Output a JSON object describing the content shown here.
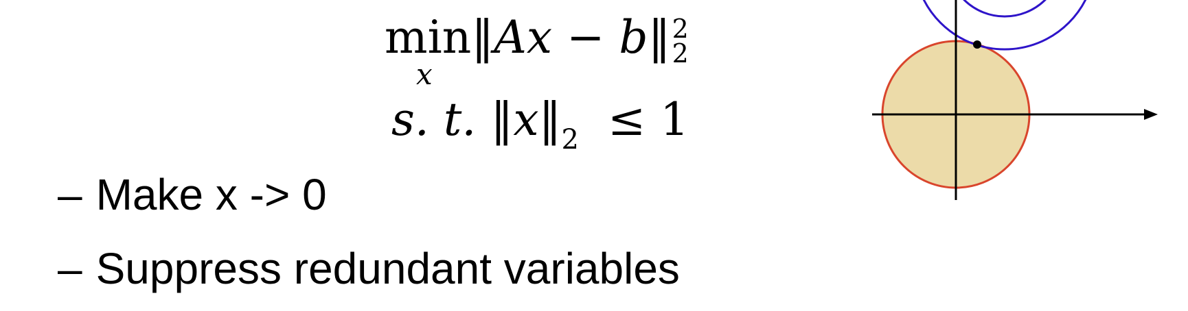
{
  "formula": {
    "objective": {
      "operator": "min",
      "operator_subscript": "x",
      "norm_open": "‖",
      "expression": "Ax − b",
      "norm_close": "‖",
      "superscript": "2",
      "subscript": "2"
    },
    "constraint": {
      "prefix": "s. t. ",
      "norm_open": "‖",
      "variable": "x",
      "norm_close": "‖",
      "subscript": "2",
      "relation": "≤ 1"
    }
  },
  "bullets": [
    {
      "dash": "–",
      "text": "Make x -> 0"
    },
    {
      "dash": "–",
      "text": "Suppress redundant variables"
    }
  ],
  "diagram": {
    "colors": {
      "feasible_fill": "#ecdba9",
      "feasible_stroke": "#d9452c",
      "contour_stroke": "#2e14c9",
      "axis": "#000000",
      "point": "#000000"
    }
  }
}
